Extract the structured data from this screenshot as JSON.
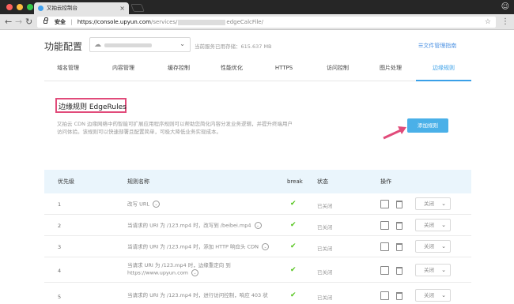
{
  "browser": {
    "tab_title": "又拍云控制台",
    "tab_close": "×",
    "secure_label": "安全",
    "url_host": "https://console.upyun.com",
    "url_path_prefix": "/services/",
    "url_path_suffix": "edgeCalcFile/"
  },
  "header": {
    "title": "功能配置",
    "storage_used": "当前服务已用存储：615.637 MB",
    "guide_link": "☰文件管理指南"
  },
  "tabs": [
    "域名管理",
    "内容管理",
    "缓存控制",
    "性能优化",
    "HTTPS",
    "访问控制",
    "图片处理",
    "边缘规则"
  ],
  "section": {
    "title": "边缘规则 EdgeRules",
    "description_line1": "又拍云 CDN 边缘网络中的智能可扩展应用程序规则可以帮助您简化内容分发业务逻辑，并提升终端用户",
    "description_line2": "访问体验。该规则可以快速部署且配置简单，可极大降低业务实现成本。",
    "add_button": "添加规则",
    "accent_color": "#e14b7a"
  },
  "table": {
    "headers": {
      "priority": "优先级",
      "rule_name": "规则名称",
      "break": "break",
      "status": "状态",
      "actions": "操作"
    },
    "rows": [
      {
        "priority": "1",
        "name_line1": "改写 URL",
        "name_line2": "",
        "status": "已关闭",
        "select": "关闭"
      },
      {
        "priority": "2",
        "name_line1": "当请求的 URI 为 /123.mp4 时，改写到 /beibei.mp4",
        "name_line2": "",
        "status": "已关闭",
        "select": "关闭"
      },
      {
        "priority": "3",
        "name_line1": "当请求的 URI 为 /123.mp4 时，添加 HTTP 响应头 CDN",
        "name_line2": "",
        "status": "已关闭",
        "select": "关闭"
      },
      {
        "priority": "4",
        "name_line1": "当请求 URI 为 /123.mp4 时，边缘重定向 到",
        "name_line2": "https://www.upyun.com",
        "status": "已关闭",
        "select": "关闭"
      },
      {
        "priority": "5",
        "name_line1": "当请求的 URI 为 /123.mp4 时，进行访问控制，响应 403 状",
        "name_line2": "",
        "status": "已关闭",
        "select": "关闭"
      }
    ]
  },
  "icons": {
    "chevron": "⌄",
    "check": "✔",
    "cloud": "☁"
  }
}
